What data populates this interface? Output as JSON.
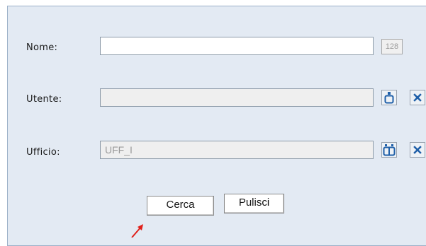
{
  "form": {
    "nome_label": "Nome:",
    "nome_value": "",
    "nome_counter": "128",
    "utente_label": "Utente:",
    "utente_value": "",
    "ufficio_label": "Ufficio:",
    "ufficio_value": "UFF_I",
    "clear_glyph": "x"
  },
  "actions": {
    "search_label": "Cerca",
    "reset_label": "Pulisci"
  },
  "icons": {
    "user_lookup": "user-icon",
    "office_lookup": "group-icon",
    "clear": "close-icon",
    "annotation": "red-arrow-icon"
  },
  "colors": {
    "panel_bg": "#e3eaf3",
    "panel_border": "#9bb0c8",
    "icon_blue": "#1f5fa8",
    "arrow_red": "#e0201a"
  }
}
